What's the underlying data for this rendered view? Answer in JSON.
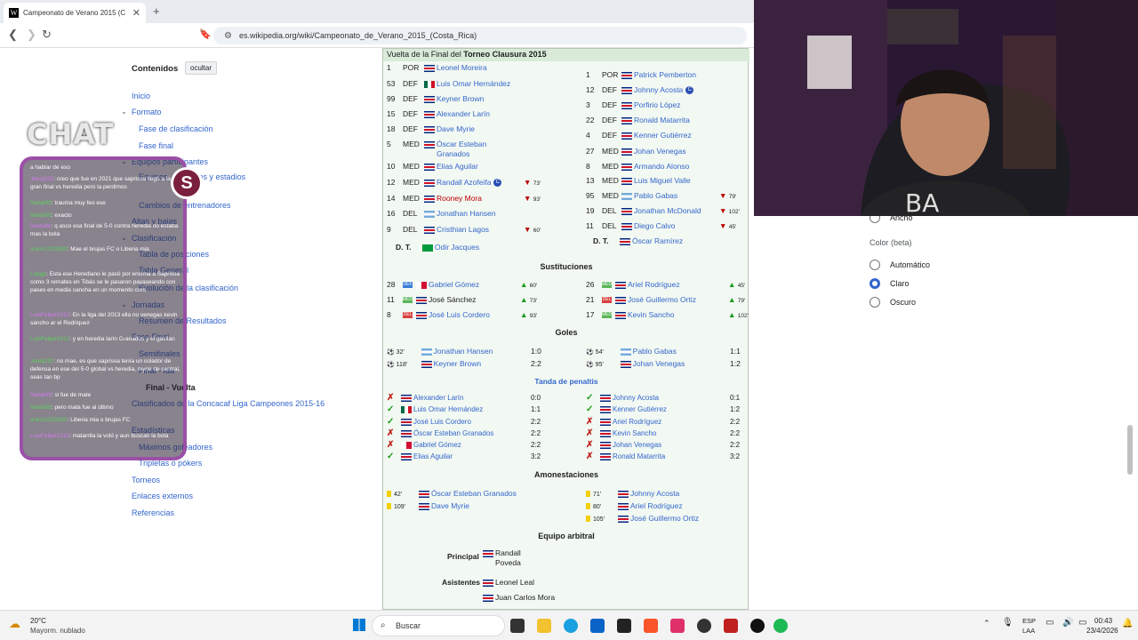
{
  "browser": {
    "tab_title": "Campeonato de Verano 2015 (C",
    "url": "es.wikipedia.org/wiki/Campeonato_de_Verano_2015_(Costa_Rica)"
  },
  "toc": {
    "heading": "Contenidos",
    "hide": "ocultar",
    "items": [
      "Inicio",
      "Formato",
      "Fase de clasificación",
      "Fase final",
      "Equipos participantes",
      "Equipos, jugadores y estadios",
      "Cambios de entrenadores",
      "Altas y bajas",
      "Clasificación",
      "Tabla de posiciones",
      "Tabla General",
      "Evolución de la clasificación",
      "Resumen de Resultados",
      "Jornadas",
      "Fase Final",
      "Semifinales",
      "Final - Ida",
      "Final - Vuelta",
      "Clasificados de la Concacaf Liga Campeones 2015-16",
      "Estadísticas",
      "Máximos goleadores",
      "Tripletas o pókers",
      "Torneos",
      "Enlaces externos",
      "Referencias"
    ]
  },
  "article": {
    "header_prefix": "Vuelta de la Final del ",
    "header_bold": "Torneo Clausura 2015",
    "home": [
      [
        "1",
        "POR",
        "Leonel Moreira"
      ],
      [
        "53",
        "DEF",
        "Luis Omar Hernández"
      ],
      [
        "99",
        "DEF",
        "Keyner Brown"
      ],
      [
        "15",
        "DEF",
        "Alexander Larín"
      ],
      [
        "18",
        "DEF",
        "Dave Myrie"
      ],
      [
        "5",
        "MED",
        "Óscar Esteban Granados"
      ],
      [
        "10",
        "MED",
        "Elias Aguilar"
      ],
      [
        "12",
        "MED",
        "Randall Azofeifa"
      ],
      [
        "14",
        "MED",
        "Rooney Mora"
      ],
      [
        "16",
        "DEL",
        "Jonathan Hansen"
      ],
      [
        "9",
        "DEL",
        "Cristhian Lagos"
      ]
    ],
    "home_coach": [
      "D. T.",
      "Odir Jacques"
    ],
    "away": [
      [
        "1",
        "POR",
        "Patrick Pemberton"
      ],
      [
        "12",
        "DEF",
        "Johnny Acosta"
      ],
      [
        "3",
        "DEF",
        "Porfirio López"
      ],
      [
        "22",
        "DEF",
        "Ronald Matarrita"
      ],
      [
        "4",
        "DEF",
        "Kenner Gutiérrez"
      ],
      [
        "27",
        "MED",
        "Johan Venegas"
      ],
      [
        "8",
        "MED",
        "Armando Alonso"
      ],
      [
        "13",
        "MED",
        "Luis Miguel Valle"
      ],
      [
        "95",
        "MED",
        "Pablo Gabas"
      ],
      [
        "19",
        "DEL",
        "Jonathan McDonald"
      ],
      [
        "11",
        "DEL",
        "Diego Calvo"
      ]
    ],
    "away_coach": [
      "D. T.",
      "Óscar Ramírez"
    ],
    "subs_title": "Sustituciones",
    "subs_home": [
      [
        "28",
        "Gabriel Gómez",
        "60'"
      ],
      [
        "11",
        "José Sánchez",
        "73'"
      ],
      [
        "8",
        "José Luis Cordero",
        "93'"
      ]
    ],
    "subs_away": [
      [
        "26",
        "Ariel Rodríguez",
        "45'"
      ],
      [
        "21",
        "José Guillermo Ortiz",
        "79'"
      ],
      [
        "17",
        "Kevin Sancho",
        "102'"
      ]
    ],
    "sub_out_home": [
      "73'",
      "93'",
      "60'"
    ],
    "sub_out_away": [
      "79'",
      "102'",
      "45'"
    ],
    "goals_title": "Goles",
    "goals_home": [
      [
        "32'",
        "Jonathan Hansen",
        "1:0"
      ],
      [
        "118'",
        "Keyner Brown",
        "2:2"
      ]
    ],
    "goals_away": [
      [
        "54'",
        "Pablo Gabas",
        "1:1"
      ],
      [
        "95'",
        "Johan Venegas",
        "1:2"
      ]
    ],
    "pen_title": "Tanda de penaltis",
    "pen_home": [
      [
        "Alexander Larín",
        "0:0"
      ],
      [
        "Luis Omar Hernández",
        "1:1"
      ],
      [
        "José Luis Cordero",
        "2:2"
      ],
      [
        "Óscar Esteban Granados",
        "2:2"
      ],
      [
        "Gabriel Gómez",
        "2:2"
      ],
      [
        "Elias Aguilar",
        "3:2"
      ]
    ],
    "pen_away": [
      [
        "Johnny Acosta",
        "0:1"
      ],
      [
        "Kenner Gutiérrez",
        "1:2"
      ],
      [
        "Ariel Rodríguez",
        "2:2"
      ],
      [
        "Kevin Sancho",
        "2:2"
      ],
      [
        "Johan Venegas",
        "2:2"
      ],
      [
        "Ronald Matarrita",
        "3:2"
      ]
    ],
    "cards_title": "Amonestaciones",
    "cards_home": [
      [
        "42'",
        "Óscar Esteban Granados"
      ],
      [
        "109'",
        "Dave Myrie"
      ]
    ],
    "cards_away": [
      [
        "71'",
        "Johnny Acosta"
      ],
      [
        "80'",
        "Ariel Rodríguez"
      ],
      [
        "105'",
        "José Guillermo Ortiz"
      ]
    ],
    "ref_title": "Equipo arbitral",
    "ref_main_label": "Principal",
    "ref_main": "Randall Poveda",
    "ref_asst_label": "Asistentes",
    "ref_asst1": "Leonel Leal",
    "ref_asst2": "Juan Carlos Mora"
  },
  "right_panel": {
    "width_option": "Ancho",
    "color_label": "Color (beta)",
    "options": [
      "Automático",
      "Claro",
      "Oscuro"
    ],
    "selected": "Claro"
  },
  "chat": {
    "title": "CHAT",
    "lines": [
      {
        "user": "",
        "text": "a hablar de eso"
      },
      {
        "user": "Jeanj232",
        "text": ": creo que fue en 2021 que saprissa llegó a la gran final vs heredia pero la perdimos"
      },
      {
        "user": "Sandi09",
        "text": ": trauma muy feo ese"
      },
      {
        "user": "Sandi09",
        "text": ": exacto"
      },
      {
        "user": "jurenafe",
        "text": ": q asco esa final de 5-0 contra heredia no estaba mas la bola"
      },
      {
        "user": "mairo1233330",
        "text": ": Mae el brujas FC o Liberia mia"
      },
      {
        "user": "Lopgp",
        "text": ": Esta ese Herediano le pasó por encima a Saprissa como 3 remates en Tibás se le pasaron payaseando con pases en media cancha en un momento creo"
      },
      {
        "user": "LuisFelipe1012",
        "text": ": En la liga del 2013 ella no venegas kevin sancho ar el Rodriquez"
      },
      {
        "user": "LuisFelipe1012",
        "text": ": y en heredia larín Granados y el gavilan"
      },
      {
        "user": "Jeanj232",
        "text": ": no mae, es que saprissa tenía un colador de defensa en ese del 5-0 global vs heredia, myrie de central, seas tan bp"
      },
      {
        "user": "Sandi09",
        "text": ": si fue de mate"
      },
      {
        "user": "Sandi09",
        "text": ": pero mata fue al último"
      },
      {
        "user": "mairo1233330",
        "text": ": Liberia mia o brujas FC"
      },
      {
        "user": "LuisFelipe1012",
        "text": ": matarrita la voló y aun buscan la bola"
      }
    ]
  },
  "taskbar": {
    "temp": "20°C",
    "weather": "Mayorm. nublado",
    "search": "Buscar",
    "lang1": "ESP",
    "lang2": "LAA",
    "time": "00:43",
    "date": "23/4/2026"
  }
}
